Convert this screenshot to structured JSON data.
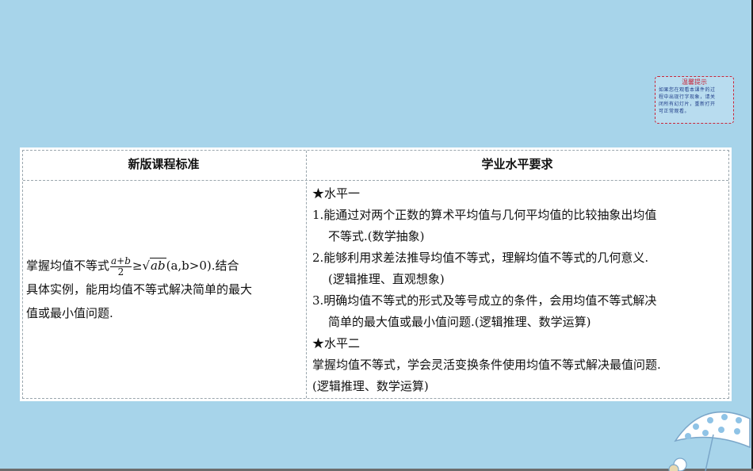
{
  "notice": {
    "title": "温馨提示",
    "lines": [
      "如果您在观看本课件的过",
      "程中出现行字现象，请关",
      "闭所有幻灯片，重新打开",
      "可正常观看。"
    ]
  },
  "table": {
    "headers": [
      "新版课程标准",
      "学业水平要求"
    ],
    "left": {
      "line1_prefix": "掌握均值不等式",
      "frac_num": "a+b",
      "frac_den": "2",
      "geq": "≥",
      "sqrt_sign": "√",
      "sqrt_content": "ab",
      "condition": "(a,b>0).结合",
      "line2": "具体实例，能用均值不等式解决简单的最大",
      "line3": "值或最小值问题."
    },
    "right": [
      "★水平一",
      "1.能通过对两个正数的算术平均值与几何平均值的比较抽象出均值",
      "不等式.(数学抽象)",
      "2.能够利用求差法推导均值不等式，理解均值不等式的几何意义.",
      "(逻辑推理、直观想象)",
      "3.明确均值不等式的形式及等号成立的条件，会用均值不等式解决",
      "简单的最大值或最小值问题.(逻辑推理、数学运算)",
      "★水平二",
      "掌握均值不等式，学会灵活变换条件使用均值不等式解决最值问题.",
      "(逻辑推理、数学运算)"
    ]
  }
}
